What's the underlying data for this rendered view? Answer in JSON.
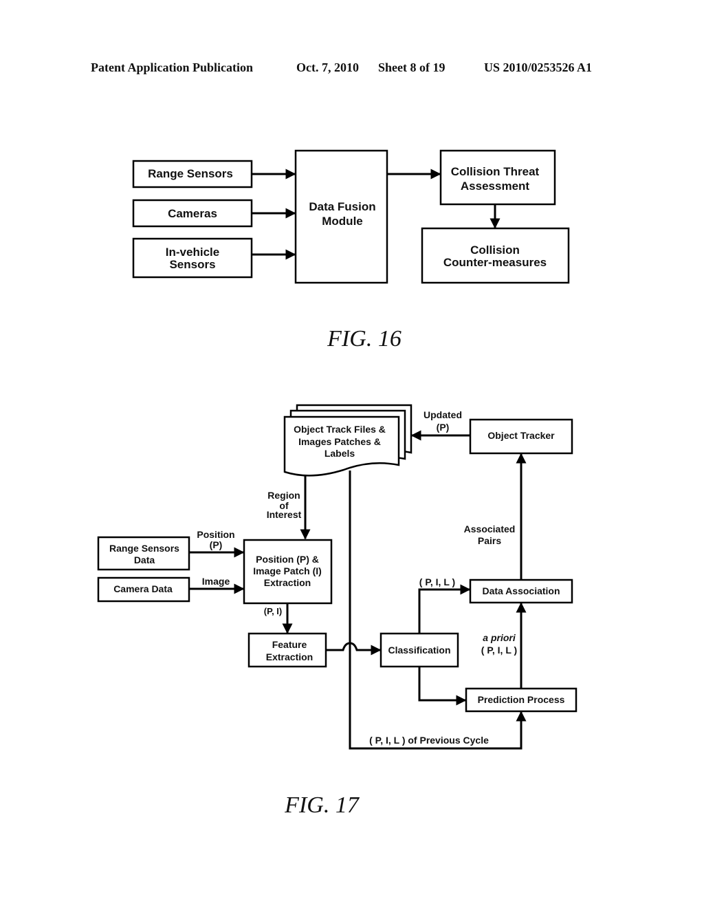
{
  "header": {
    "publication": "Patent Application Publication",
    "date": "Oct. 7, 2010",
    "sheet": "Sheet 8 of 19",
    "number": "US 2010/0253526 A1"
  },
  "fig16": {
    "caption": "FIG. 16",
    "range_sensors": "Range Sensors",
    "cameras": "Cameras",
    "in_vehicle_1": "In-vehicle",
    "in_vehicle_2": "Sensors",
    "fusion_1": "Data Fusion",
    "fusion_2": "Module",
    "threat_1": "Collision Threat",
    "threat_2": "Assessment",
    "counter_1": "Collision",
    "counter_2": "Counter-measures"
  },
  "fig17": {
    "caption": "FIG. 17",
    "track_files_1": "Object Track Files &",
    "track_files_2": "Images Patches &",
    "track_files_3": "Labels",
    "updated_1": "Updated",
    "updated_2": "(P)",
    "object_tracker": "Object Tracker",
    "roi_1": "Region",
    "roi_2": "of",
    "roi_3": "Interest",
    "position_1": "Position",
    "position_2": "(P)",
    "range_data_1": "Range Sensors",
    "range_data_2": "Data",
    "camera_data": "Camera Data",
    "image": "Image",
    "extraction_1": "Position (P) &",
    "extraction_2": "Image Patch (I)",
    "extraction_3": "Extraction",
    "pi": "(P, I)",
    "feature_1": "Feature",
    "feature_2": "Extraction",
    "classification": "Classification",
    "pil_top": "( P, I, L )",
    "data_association": "Data Association",
    "associated_1": "Associated",
    "associated_2": "Pairs",
    "apriori_1": "a priori",
    "apriori_2": "( P, I, L )",
    "prediction": "Prediction Process",
    "previous_cycle": "( P, I, L ) of Previous Cycle"
  }
}
